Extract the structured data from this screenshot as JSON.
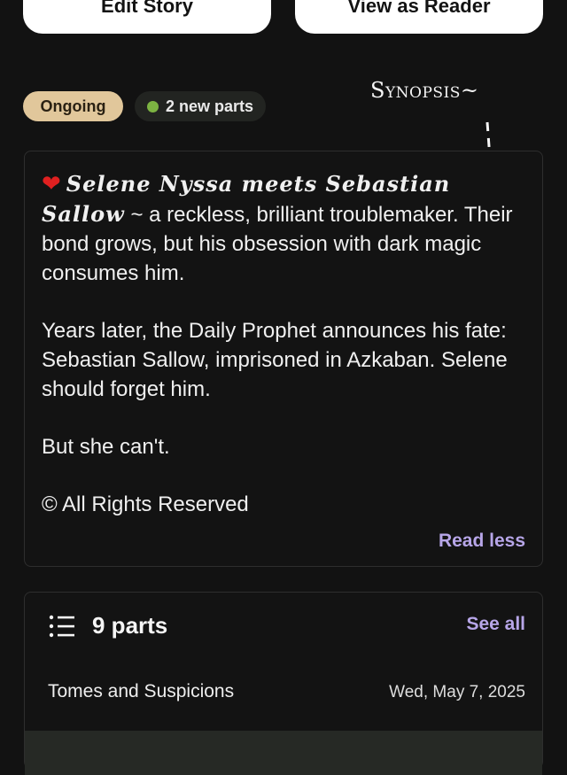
{
  "buttons": {
    "edit_story": "Edit Story",
    "view_as_reader": "View as Reader"
  },
  "status": {
    "ongoing": "Ongoing",
    "new_parts": "2 new parts"
  },
  "annotation": {
    "synopsis_label": "Synopsis~"
  },
  "synopsis": {
    "heart_icon": "heart-icon",
    "names": "Selene Nyssa meets Sebastian Sallow",
    "tilde": "~",
    "line1_rest": "a reckless, brilliant troublemaker. Their bond grows, but his obsession with dark magic consumes him.",
    "paragraph2": "Years later, the Daily Prophet announces his fate: Sebastian Sallow, imprisoned in Azkaban. Selene should forget him.",
    "paragraph3": "But she can't.",
    "copyright": "© All Rights Reserved",
    "read_less": "Read less"
  },
  "parts": {
    "count_label": "9 parts",
    "see_all": "See all",
    "items": [
      {
        "title": "Tomes and Suspicions",
        "date": "Wed, May 7, 2025"
      }
    ]
  },
  "colors": {
    "background": "#121212",
    "ongoing_badge": "#e1c79b",
    "new_parts_dot": "#7cb342",
    "link_accent": "#b7a6e8"
  }
}
